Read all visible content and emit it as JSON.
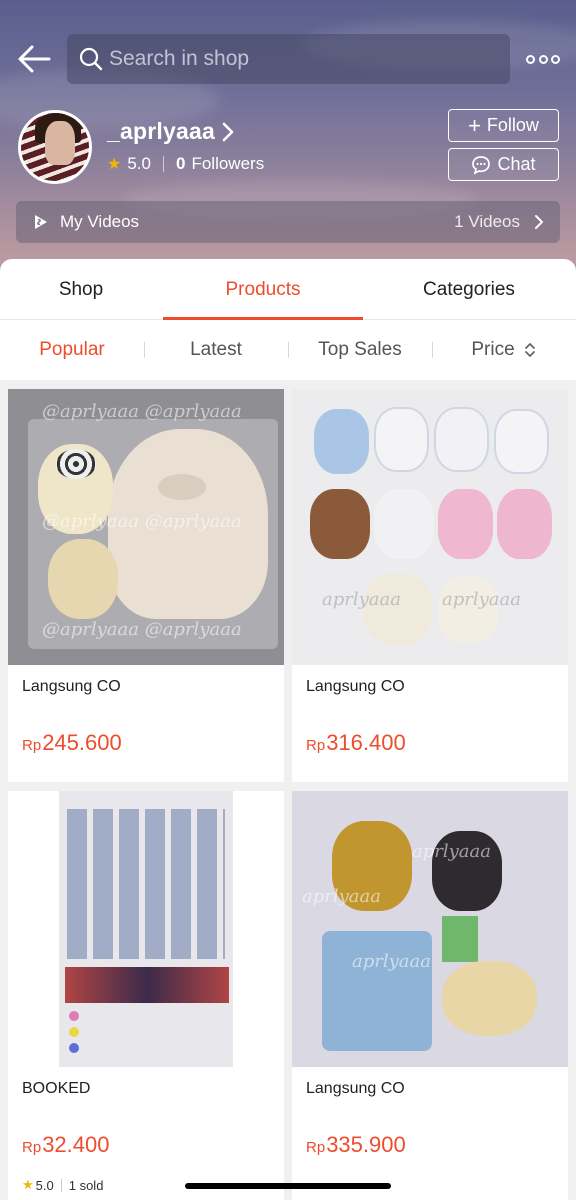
{
  "header": {
    "search_placeholder": "Search in shop",
    "shop_name": "_aprlyaaa",
    "rating": "5.0",
    "followers_count": "0",
    "followers_label": "Followers",
    "follow_label": "Follow",
    "chat_label": "Chat",
    "videos_label": "My Videos",
    "videos_count": "1 Videos"
  },
  "tabs": [
    {
      "label": "Shop",
      "active": false
    },
    {
      "label": "Products",
      "active": true
    },
    {
      "label": "Categories",
      "active": false
    }
  ],
  "sort": [
    {
      "label": "Popular",
      "active": true
    },
    {
      "label": "Latest",
      "active": false
    },
    {
      "label": "Top Sales",
      "active": false
    },
    {
      "label": "Price",
      "active": false
    }
  ],
  "products": [
    {
      "title": "Langsung CO",
      "currency": "Rp",
      "price": "245.600",
      "watermark": "@aprlyaaa @aprlyaaa"
    },
    {
      "title": "Langsung CO",
      "currency": "Rp",
      "price": "316.400",
      "watermark": "aprlyaaa"
    },
    {
      "title": "BOOKED",
      "currency": "Rp",
      "price": "32.400",
      "rating": "5.0",
      "sold": "1 sold"
    },
    {
      "title": "Langsung CO",
      "currency": "Rp",
      "price": "335.900",
      "watermark": "aprlyaaa"
    }
  ],
  "colors": {
    "accent": "#ee4d2d",
    "star": "#f5b400"
  },
  "icons": [
    "back-arrow-icon",
    "search-icon",
    "more-icon",
    "plus-icon",
    "chat-bubble-icon",
    "video-icon",
    "chevron-right-icon",
    "sort-updown-icon",
    "star-icon"
  ]
}
